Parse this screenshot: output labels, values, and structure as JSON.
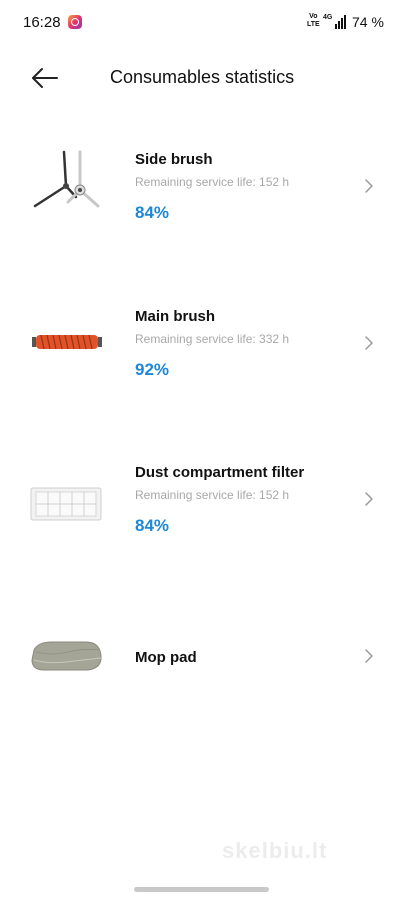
{
  "status_bar": {
    "time": "16:28",
    "volte_line1": "Vo",
    "volte_line2": "LTE",
    "battery": "74 %",
    "icons": [
      "instagram-icon",
      "volte-icon",
      "signal-4g-icon"
    ]
  },
  "header": {
    "title": "Consumables statistics",
    "back_icon": "arrow-left-icon"
  },
  "items": [
    {
      "name": "Side brush",
      "life": "Remaining service life: 152 h",
      "percent": "84%"
    },
    {
      "name": "Main brush",
      "life": "Remaining service life: 332 h",
      "percent": "92%"
    },
    {
      "name": "Dust compartment filter",
      "life": "Remaining service life: 152 h",
      "percent": "84%"
    },
    {
      "name": "Mop pad",
      "life": "",
      "percent": ""
    }
  ],
  "watermark": "skelbiu.lt",
  "colors": {
    "accent": "#1d88d6",
    "secondary_text": "#a8a8a8",
    "brush_orange": "#e0532a"
  }
}
